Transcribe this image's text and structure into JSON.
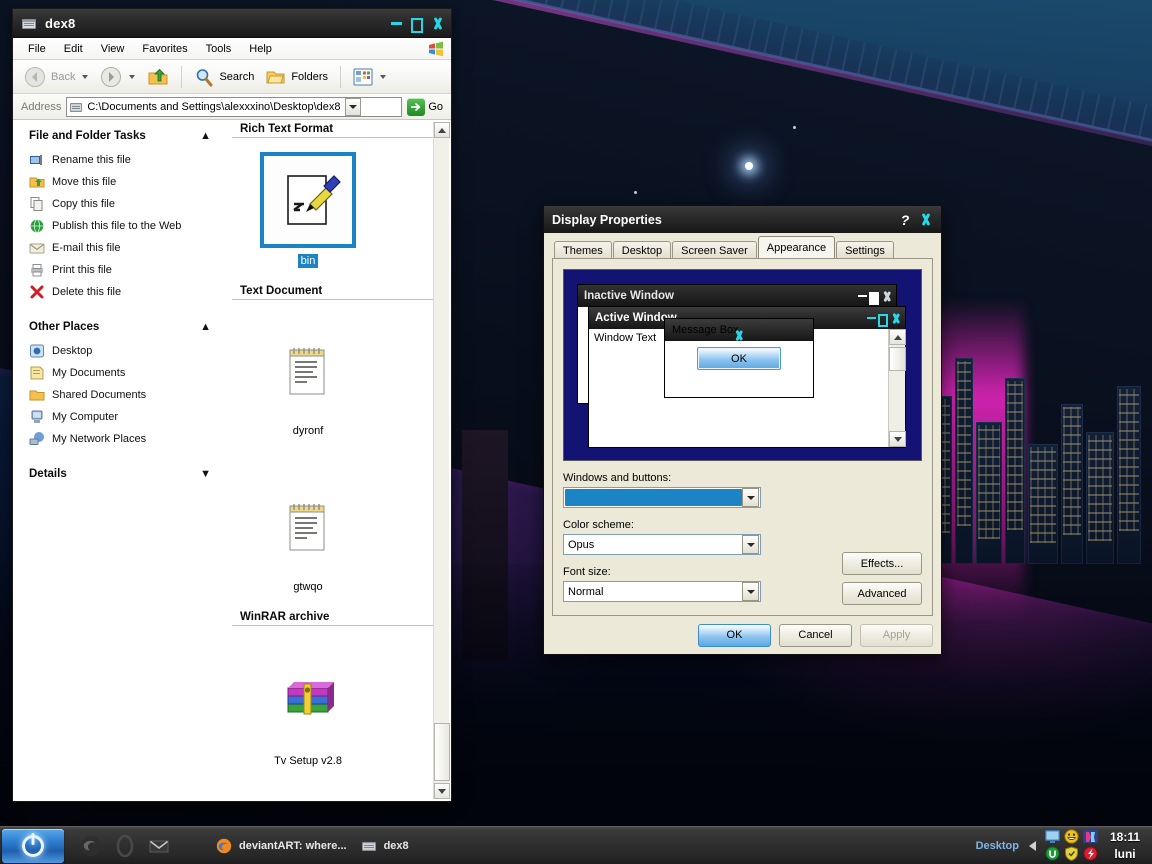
{
  "desktop": {
    "wallpaper_description": "night bridge over water with magenta glow and city skyline",
    "colors": {
      "sky": "#1a4a6b",
      "glow": "#ff28c8",
      "water": "#02030a"
    }
  },
  "explorer": {
    "title": "dex8",
    "title_icon": "folder-icon",
    "window_buttons": [
      "minimize",
      "maximize",
      "close"
    ],
    "menu": [
      "File",
      "Edit",
      "View",
      "Favorites",
      "Tools",
      "Help"
    ],
    "toolbar": {
      "back_label": "Back",
      "forward_label": "",
      "up_label": "",
      "search_label": "Search",
      "folders_label": "Folders",
      "views_label": ""
    },
    "address": {
      "label": "Address",
      "value": "C:\\Documents and Settings\\alexxxino\\Desktop\\dex8",
      "go_label": "Go"
    },
    "task_pane": {
      "groups": [
        {
          "title": "File and Folder Tasks",
          "chevron": "collapse",
          "items": [
            {
              "label": "Rename this file",
              "icon": "rename-icon"
            },
            {
              "label": "Move this file",
              "icon": "move-icon"
            },
            {
              "label": "Copy this file",
              "icon": "copy-icon"
            },
            {
              "label": "Publish this file to the Web",
              "icon": "publish-web-icon"
            },
            {
              "label": "E-mail this file",
              "icon": "email-icon"
            },
            {
              "label": "Print this file",
              "icon": "print-icon"
            },
            {
              "label": "Delete this file",
              "icon": "delete-x-icon"
            }
          ]
        },
        {
          "title": "Other Places",
          "chevron": "collapse",
          "items": [
            {
              "label": "Desktop",
              "icon": "desktop-icon"
            },
            {
              "label": "My Documents",
              "icon": "my-documents-icon"
            },
            {
              "label": "Shared Documents",
              "icon": "shared-folder-icon"
            },
            {
              "label": "My Computer",
              "icon": "my-computer-icon"
            },
            {
              "label": "My Network Places",
              "icon": "network-places-icon"
            }
          ]
        },
        {
          "title": "Details",
          "chevron": "expand",
          "items": []
        }
      ]
    },
    "file_groups": [
      {
        "header": "Rich Text Format",
        "files": [
          {
            "name": "bin",
            "icon": "rtf-file-icon",
            "selected": true
          }
        ]
      },
      {
        "header": "Text Document",
        "files": [
          {
            "name": "dyronf",
            "icon": "text-document-icon",
            "selected": false
          },
          {
            "name": "gtwqo",
            "icon": "text-document-icon",
            "selected": false
          }
        ]
      },
      {
        "header": "WinRAR archive",
        "files": [
          {
            "name": "Tv Setup v2.8",
            "icon": "winrar-archive-icon",
            "selected": false
          }
        ]
      }
    ]
  },
  "display_properties": {
    "title": "Display Properties",
    "help_button": "?",
    "close_button": "close",
    "tabs": [
      {
        "label": "Themes",
        "active": false
      },
      {
        "label": "Desktop",
        "active": false
      },
      {
        "label": "Screen Saver",
        "active": false
      },
      {
        "label": "Appearance",
        "active": true
      },
      {
        "label": "Settings",
        "active": false
      }
    ],
    "preview": {
      "inactive_window_title": "Inactive Window",
      "active_window_title": "Active Window",
      "window_text": "Window Text",
      "message_box_title": "Message Box",
      "message_box_button": "OK",
      "background_color": "#131374"
    },
    "fields": [
      {
        "label": "Windows and buttons:",
        "value": "",
        "value_is_swatch": true,
        "swatch_color": "#1a84c4"
      },
      {
        "label": "Color scheme:",
        "value": "Opus",
        "value_is_swatch": false
      },
      {
        "label": "Font size:",
        "value": "Normal",
        "value_is_swatch": false
      }
    ],
    "side_buttons": [
      {
        "label": "Effects...",
        "enabled": true
      },
      {
        "label": "Advanced",
        "enabled": true
      }
    ],
    "footer_buttons": [
      {
        "label": "OK",
        "primary": true,
        "enabled": true
      },
      {
        "label": "Cancel",
        "primary": false,
        "enabled": true
      },
      {
        "label": "Apply",
        "primary": false,
        "enabled": false
      }
    ]
  },
  "taskbar": {
    "start_label": "",
    "start_icon": "power-icon",
    "quick_launch": [
      {
        "name": "firefox-icon"
      },
      {
        "name": "opera-icon"
      },
      {
        "name": "mail-icon"
      }
    ],
    "tasks": [
      {
        "label": "deviantART: where...",
        "icon": "firefox-icon"
      },
      {
        "label": "dex8",
        "icon": "folder-icon"
      }
    ],
    "show_desktop_label": "Desktop",
    "tray_icons": [
      "monitor-icon",
      "smiley-icon",
      "media-icon",
      "utorrent-icon",
      "shield-icon",
      "antivirus-icon"
    ],
    "clock_time": "18:11",
    "clock_day": "luni"
  }
}
